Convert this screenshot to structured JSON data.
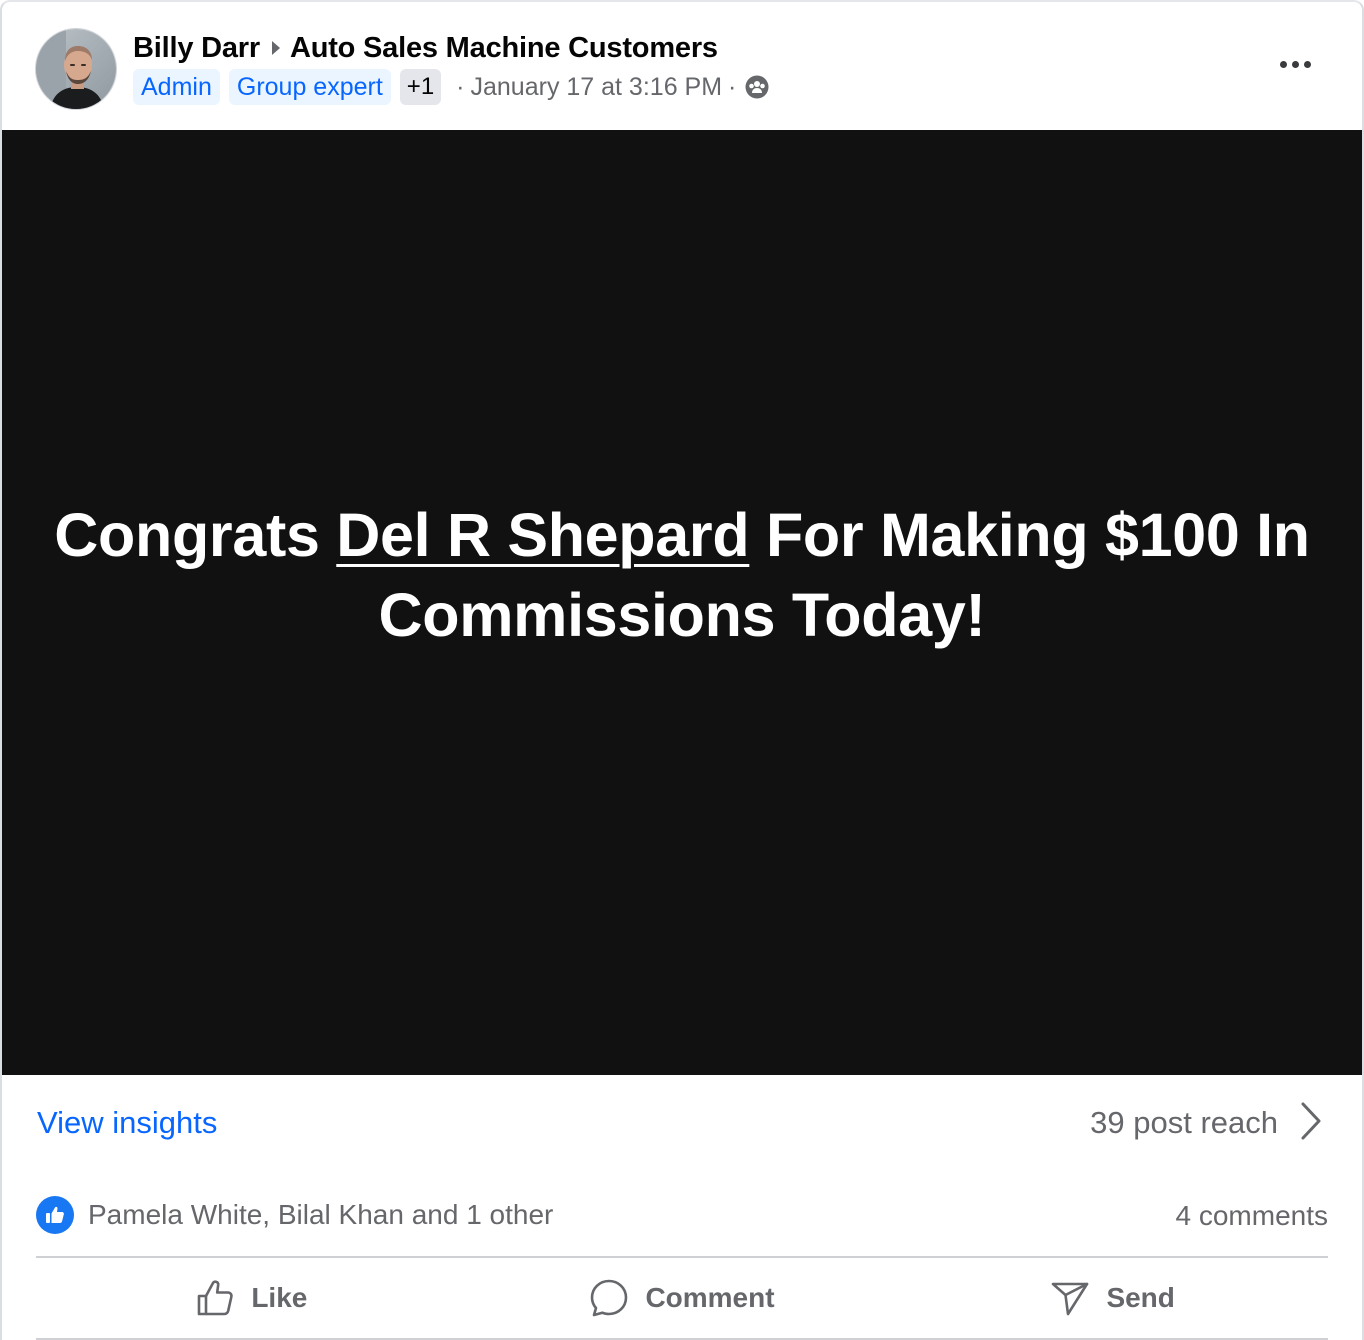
{
  "post": {
    "author": "Billy Darr",
    "group": "Auto Sales Machine Customers",
    "badges": [
      "Admin",
      "Group expert"
    ],
    "badge_more": "+1",
    "timestamp": "January 17 at 3:16 PM",
    "separator": "·",
    "privacy_icon": "group-members-icon",
    "more_icon": "more-options-icon"
  },
  "media": {
    "text_before": "Congrats ",
    "mention": "Del R Shepard",
    "text_after": " For Making $100 In Commissions Today!"
  },
  "insights": {
    "view_label": "View insights",
    "reach_label": "39 post reach"
  },
  "reactions": {
    "reactors": "Pamela White, Bilal Khan and 1 other",
    "comments": "4 comments"
  },
  "actions": {
    "like": "Like",
    "comment": "Comment",
    "send": "Send"
  },
  "colors": {
    "accent": "#0866ff",
    "like_blue": "#1877f2",
    "media_bg": "#111111",
    "secondary_text": "#65676b"
  }
}
